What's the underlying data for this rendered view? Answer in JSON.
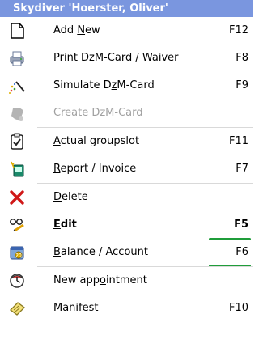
{
  "menu": {
    "header_title": "Skydiver 'Hoerster, Oliver'",
    "items": [
      {
        "pre": "Add ",
        "ul": "N",
        "post": "ew",
        "shortcut": "F12",
        "icon": "new-document-icon",
        "enabled": true
      },
      {
        "pre": "",
        "ul": "P",
        "post": "rint DzM-Card / Waiver",
        "shortcut": "F8",
        "icon": "printer-icon",
        "enabled": true
      },
      {
        "pre": "Simulate D",
        "ul": "z",
        "post": "M-Card",
        "shortcut": "F9",
        "icon": "magic-wand-icon",
        "enabled": true
      },
      {
        "pre": "",
        "ul": "C",
        "post": "reate DzM-Card",
        "shortcut": "",
        "icon": "card-icon",
        "enabled": false
      },
      {
        "pre": "",
        "ul": "A",
        "post": "ctual groupslot",
        "shortcut": "F11",
        "icon": "checklist-icon",
        "enabled": true
      },
      {
        "pre": "",
        "ul": "R",
        "post": "eport / Invoice",
        "shortcut": "F7",
        "icon": "report-icon",
        "enabled": true
      },
      {
        "pre": "",
        "ul": "D",
        "post": "elete",
        "shortcut": "",
        "icon": "delete-x-icon",
        "enabled": true
      },
      {
        "pre": "",
        "ul": "E",
        "post": "dit",
        "shortcut": "F5",
        "icon": "edit-glasses-icon",
        "enabled": true,
        "bold": true
      },
      {
        "pre": "",
        "ul": "B",
        "post": "alance / Account",
        "shortcut": "F6",
        "icon": "calendar-balance-icon",
        "enabled": true
      },
      {
        "pre": "New app",
        "ul": "o",
        "post": "intment",
        "shortcut": "",
        "icon": "appointment-icon",
        "enabled": true
      },
      {
        "pre": "",
        "ul": "M",
        "post": "anifest",
        "shortcut": "F10",
        "icon": "manifest-icon",
        "enabled": true
      }
    ]
  },
  "colors": {
    "header_bg": "#7a96df",
    "accent_green": "#1f9d3a",
    "disabled_text": "#a0a0a0"
  }
}
